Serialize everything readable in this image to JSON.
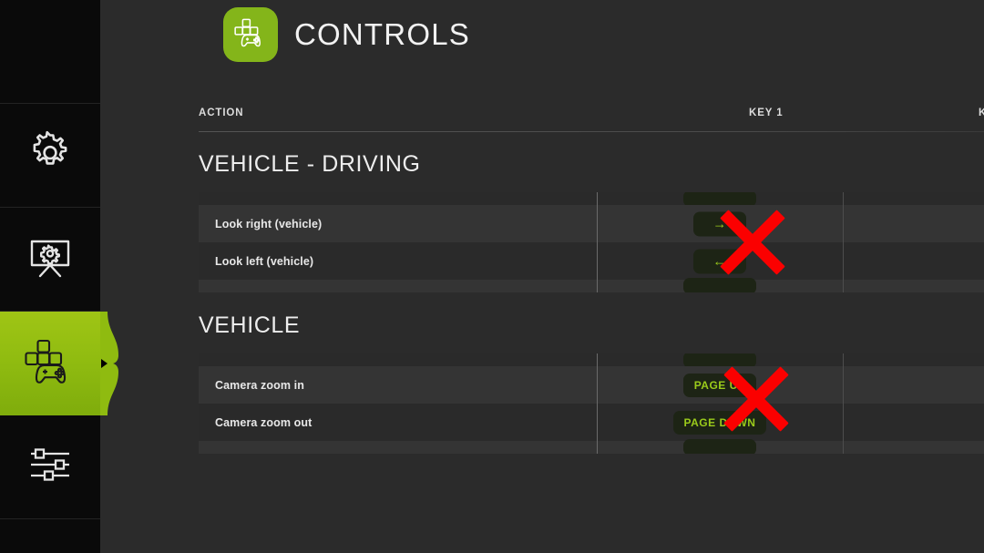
{
  "sidebar": {
    "items": [
      {
        "id": "blank-top",
        "icon": "none",
        "label": "",
        "active": false
      },
      {
        "id": "settings",
        "icon": "gear-icon",
        "label": "Settings",
        "active": false
      },
      {
        "id": "display",
        "icon": "monitor-gear-icon",
        "label": "Display Settings",
        "active": false
      },
      {
        "id": "controls",
        "icon": "gamepad-keys-icon",
        "label": "Controls",
        "active": true
      },
      {
        "id": "levels",
        "icon": "sliders-icon",
        "label": "Levels",
        "active": false
      }
    ]
  },
  "header": {
    "title": "CONTROLS",
    "badge_icon": "gamepad-keys-icon",
    "badge_color": "#84b51a"
  },
  "table": {
    "columns": {
      "action": "ACTION",
      "key1": "KEY 1",
      "key2": "K"
    },
    "sections": [
      {
        "title": "VEHICLE - DRIVING",
        "clipped_top_chip": "",
        "rows": [
          {
            "action": "Look right (vehicle)",
            "key1": "→",
            "key1_type": "arrow",
            "key2": ""
          },
          {
            "action": "Look left (vehicle)",
            "key1": "←",
            "key1_type": "arrow",
            "key2": ""
          }
        ],
        "clipped_bottom_chip": ""
      },
      {
        "title": "VEHICLE",
        "clipped_top_chip": "",
        "rows": [
          {
            "action": "Camera zoom in",
            "key1": "PAGE UP",
            "key1_type": "text",
            "key2": ""
          },
          {
            "action": "Camera zoom out",
            "key1": "PAGE DOWN",
            "key1_type": "text",
            "key2": ""
          }
        ],
        "clipped_bottom_chip": ""
      }
    ]
  },
  "annotations": {
    "marks": [
      {
        "id": "mark-driving",
        "shape": "red-x",
        "color": "#fb0000"
      },
      {
        "id": "mark-vehicle",
        "shape": "red-x",
        "color": "#fb0000"
      }
    ]
  },
  "colors": {
    "accent_green": "#9fc515",
    "chip_text": "#9bcb1b",
    "chip_bg": "#1d2415",
    "panel_bg": "#2b2b2b",
    "sidebar_bg": "#0a0a0a",
    "row_odd": "#343434",
    "row_even": "#2a2a2a",
    "mark_red": "#fb0000"
  }
}
